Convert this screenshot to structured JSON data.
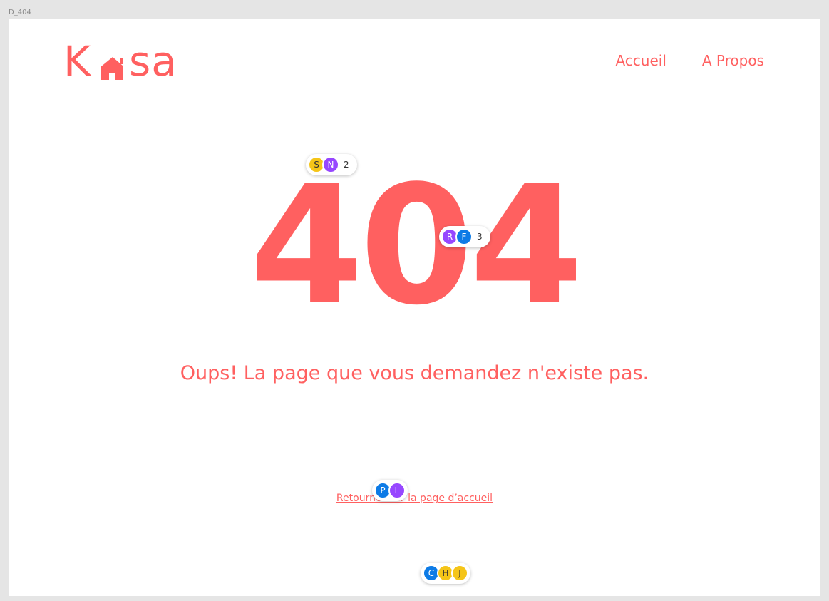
{
  "frame_label": "D_404",
  "brand": {
    "logo_left": "K",
    "logo_right": "sa",
    "color": "#ff6060"
  },
  "nav": {
    "home": "Accueil",
    "about": "A Propos"
  },
  "error": {
    "code": "404",
    "message": "Oups! La page que vous demandez n'existe pas.",
    "home_link": "Retourner sur la page d’accueil"
  },
  "collaborators": {
    "group1": {
      "avatars": [
        {
          "initial": "S",
          "color": "#f5c518"
        },
        {
          "initial": "N",
          "color": "#9747ff"
        }
      ],
      "count": "2"
    },
    "group2": {
      "avatars": [
        {
          "initial": "R",
          "color": "#9747ff"
        },
        {
          "initial": "F",
          "color": "#0d7be6"
        }
      ],
      "count": "3"
    },
    "group3": {
      "avatars": [
        {
          "initial": "P",
          "color": "#0d7be6"
        },
        {
          "initial": "L",
          "color": "#9747ff"
        }
      ]
    },
    "group4": {
      "avatars": [
        {
          "initial": "C",
          "color": "#0d7be6"
        },
        {
          "initial": "H",
          "color": "#f5c518"
        },
        {
          "initial": "J",
          "color": "#f5c518"
        }
      ]
    }
  }
}
